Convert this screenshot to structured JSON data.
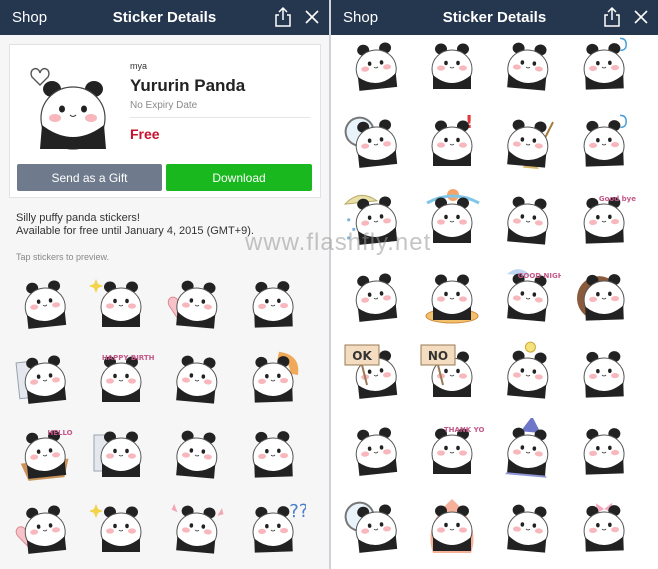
{
  "nav": {
    "back": "Shop",
    "title": "Sticker Details"
  },
  "product": {
    "creator": "mya",
    "name": "Yururin Panda",
    "expiry": "No Expiry Date",
    "price": "Free",
    "gift_label": "Send as a Gift",
    "download_label": "Download"
  },
  "description": [
    "Silly puffy panda stickers!",
    "Available for free until January 4, 2015 (GMT+9)."
  ],
  "hint": "Tap stickers to preview.",
  "watermark": "www.flashfly.net",
  "stickers_left": [
    {
      "pose": "lying"
    },
    {
      "pose": "sparkle"
    },
    {
      "pose": "heart"
    },
    {
      "pose": "angry"
    },
    {
      "pose": "scared"
    },
    {
      "pose": "party",
      "text": "HAPPY BIRTHDAY"
    },
    {
      "pose": "bow"
    },
    {
      "pose": "shrimp"
    },
    {
      "pose": "basket",
      "text": "HELLO"
    },
    {
      "pose": "towel"
    },
    {
      "pose": "hug"
    },
    {
      "pose": "shy"
    },
    {
      "pose": "love"
    },
    {
      "pose": "sparkle2"
    },
    {
      "pose": "hearts"
    },
    {
      "pose": "question"
    }
  ],
  "stickers_right": [
    {
      "pose": "peek"
    },
    {
      "pose": "sit"
    },
    {
      "pose": "cheer"
    },
    {
      "pose": "dizzy"
    },
    {
      "pose": "magnifier"
    },
    {
      "pose": "exclaim"
    },
    {
      "pose": "broom"
    },
    {
      "pose": "dizzy2"
    },
    {
      "pose": "rain"
    },
    {
      "pose": "bath"
    },
    {
      "pose": "stand"
    },
    {
      "pose": "goodbye",
      "text": "Good bye!"
    },
    {
      "pose": "dots"
    },
    {
      "pose": "ring"
    },
    {
      "pose": "night",
      "text": "GOOD NIGHT"
    },
    {
      "pose": "donut"
    },
    {
      "pose": "sign",
      "text": "OK"
    },
    {
      "pose": "sign2",
      "text": "NO"
    },
    {
      "pose": "idea"
    },
    {
      "pose": "bigstand"
    },
    {
      "pose": "tall"
    },
    {
      "pose": "thankyou",
      "text": "THANK YOU"
    },
    {
      "pose": "wizard"
    },
    {
      "pose": "cool"
    },
    {
      "pose": "mirror"
    },
    {
      "pose": "fire"
    },
    {
      "pose": "stand2"
    },
    {
      "pose": "ribbon"
    }
  ],
  "colors": {
    "nav": "#25364f",
    "price": "#c8102e",
    "download": "#19b81e",
    "gift": "#6f7b8c"
  }
}
